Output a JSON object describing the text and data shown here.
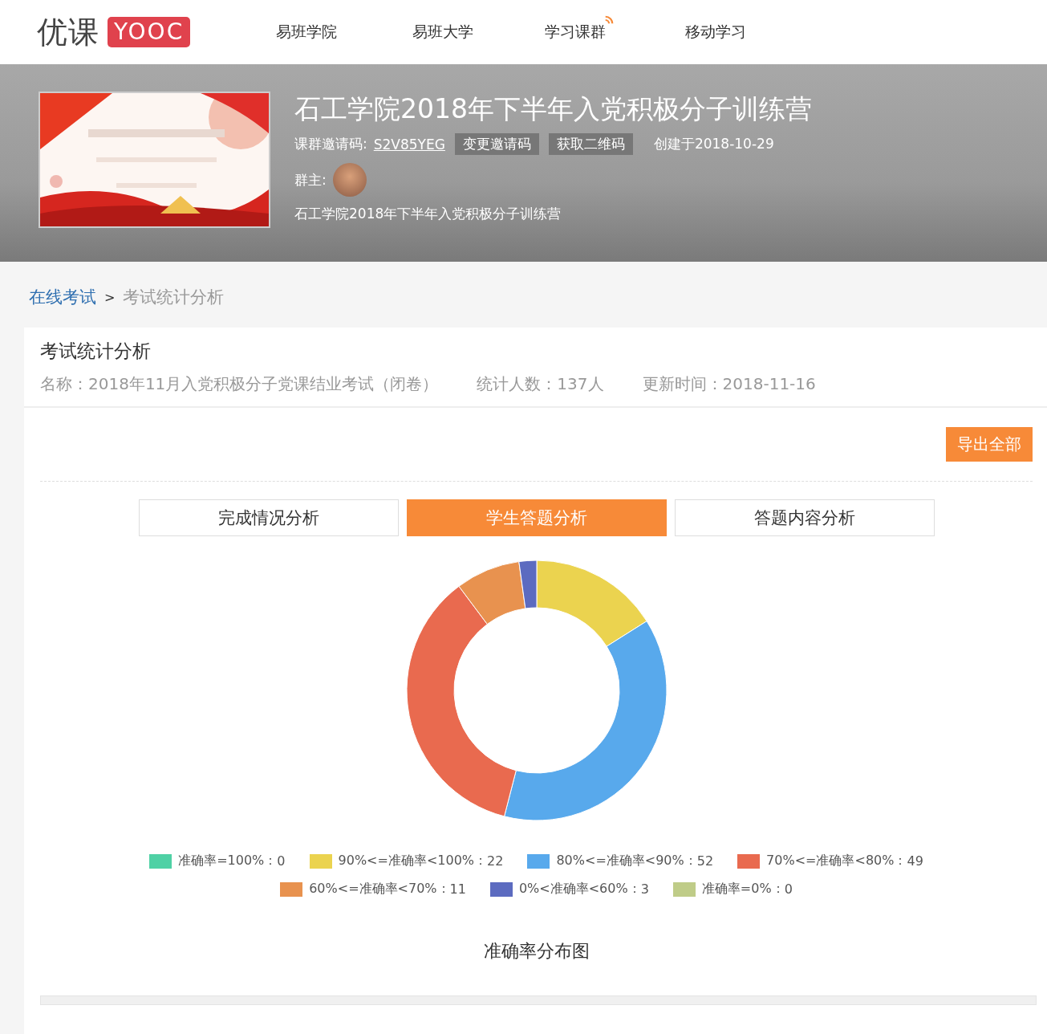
{
  "header": {
    "logo_text": "优课",
    "logo_badge": "YOOC",
    "nav": [
      {
        "label": "易班学院",
        "badge": false
      },
      {
        "label": "易班大学",
        "badge": false
      },
      {
        "label": "学习课群",
        "badge": true
      },
      {
        "label": "移动学习",
        "badge": false
      }
    ]
  },
  "course": {
    "title": "石工学院2018年下半年入党积极分子训练营",
    "invite_label": "课群邀请码:",
    "invite_code": "S2V85YEG",
    "buttons": [
      "变更邀请码",
      "获取二维码"
    ],
    "created": "创建于2018-10-29",
    "owner_label": "群主:",
    "description": "石工学院2018年下半年入党积极分子训练营"
  },
  "breadcrumb": [
    "在线考试",
    "考试统计分析"
  ],
  "breadcrumb_separator": ">",
  "panel": {
    "title": "考试统计分析",
    "meta": [
      "名称：2018年11月入党积极分子党课结业考试（闭卷）",
      "统计人数：137人",
      "更新时间：2018-11-16"
    ],
    "export_button": "导出全部",
    "tabs": [
      {
        "label": "完成情况分析",
        "selected": false
      },
      {
        "label": "学生答题分析",
        "selected": true
      },
      {
        "label": "答题内容分析",
        "selected": false
      }
    ],
    "chart_data": {
      "type": "donut",
      "title": "准确率分布图",
      "categories": [
        "准确率=100%",
        "90%<=准确率<100%",
        "80%<=准确率<90%",
        "70%<=准确率<80%",
        "60%<=准确率<70%",
        "0%<准确率<60%",
        "准确率=0%"
      ],
      "values": [
        0,
        22,
        52,
        49,
        11,
        3,
        0
      ],
      "value_labels": [
        "0",
        "22",
        "52",
        "49",
        "11",
        "3",
        "0"
      ],
      "legend": "bottom"
    },
    "legend_separator": "：",
    "legend": [
      {
        "color": "#4fd1a5"
      },
      {
        "color": "#ebd34f"
      },
      {
        "color": "#58a9ec"
      },
      {
        "color": "#e96a4f"
      },
      {
        "color": "#e8924f"
      },
      {
        "color": "#5c6bc0"
      },
      {
        "color": "#bfcc88"
      }
    ]
  }
}
